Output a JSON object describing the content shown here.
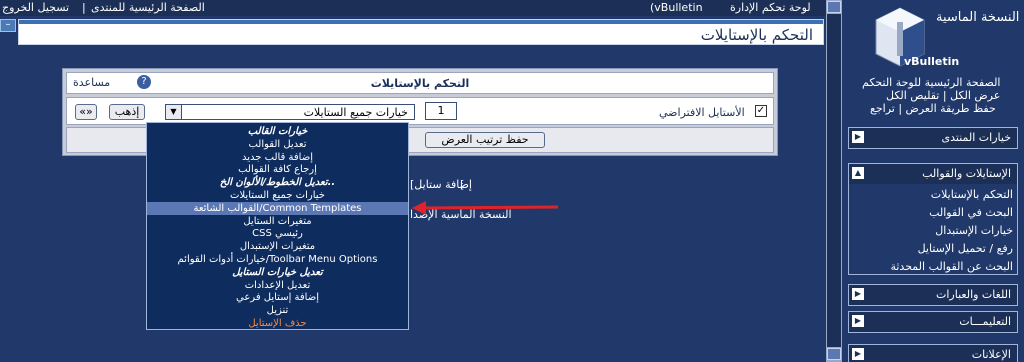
{
  "topbar": {
    "right_link": "لوحة تحكم الإدارة",
    "brand": "(vBulletin",
    "home_link": "الصفحة الرئيسية للمنتدى",
    "logout_link": "تسجيل الخروج",
    "separator": "|"
  },
  "header": {
    "title": "التحكم بالإستايلات",
    "minimize": "–"
  },
  "panel": {
    "title": "التحكم بالإستايلات",
    "help": "مساعدة",
    "help_icon_glyph": "?",
    "default_style_label": "الأستايل الافتراضي",
    "order_value": "1",
    "select_value": "خيارات جميع الستايلات",
    "go_button": "إذهب",
    "expand_button": "«»",
    "save_order_button": "حفظ ترتيب العرض"
  },
  "below": {
    "add_style_link": "[إضافة ستايل",
    "add_bracket": "[",
    "footer_text": "النسخة الماسية الإصدا"
  },
  "dropdown": [
    {
      "label": "خيارات القالب",
      "type": "group"
    },
    {
      "label": "تعديل القوالب",
      "type": "item"
    },
    {
      "label": "إضافة قالب جديد",
      "type": "item"
    },
    {
      "label": "إرجاع كافة القوالب",
      "type": "item"
    },
    {
      "label": "تعديل الخطوط/الألوان الخ..",
      "type": "group"
    },
    {
      "label": "خيارات جميع الستايلات",
      "type": "item"
    },
    {
      "label": "القوالب الشائعة/Common Templates",
      "type": "highlight"
    },
    {
      "label": "متغيرات الستايل",
      "type": "item"
    },
    {
      "label": "CSS رئيسي",
      "type": "item"
    },
    {
      "label": "متغيرات الإستبدال",
      "type": "item"
    },
    {
      "label": "خيارات أدوات القوائم/Toolbar Menu Options",
      "type": "item"
    },
    {
      "label": "تعديل خيارات الستايل",
      "type": "group"
    },
    {
      "label": "تعديل الإعدادات",
      "type": "item"
    },
    {
      "label": "إضافة إستايل فرعي",
      "type": "item"
    },
    {
      "label": "تنزيل",
      "type": "item"
    },
    {
      "label": "حذف الإستايل",
      "type": "red"
    }
  ],
  "sidebar": {
    "logo_title": "النسخة الماسية",
    "logo_sub": "vBulletin",
    "cp_home": "الصفحة الرئيسية للوحة التحكم",
    "expand_collapse": "عرض الكل | تقليص الكل",
    "save_view": "حفظ طريقة العرض | تراجع",
    "forum_options": "خيارات المنتدى",
    "styles_section": "الإستايلات والقوالب",
    "styles_items": [
      "التحكم بالإستايلات",
      "البحث في القوالب",
      "خيارات الإستبدال",
      "رفع / تحميل الإستايل",
      "البحث عن القوالب المحدثة"
    ],
    "languages": "اللغات والعبارات",
    "help_section": "التعليمـــات",
    "ads": "الإعلانات"
  },
  "colors": {
    "background": "#20386a",
    "highlight": "#5c78b4",
    "arrow": "#e0232a"
  }
}
